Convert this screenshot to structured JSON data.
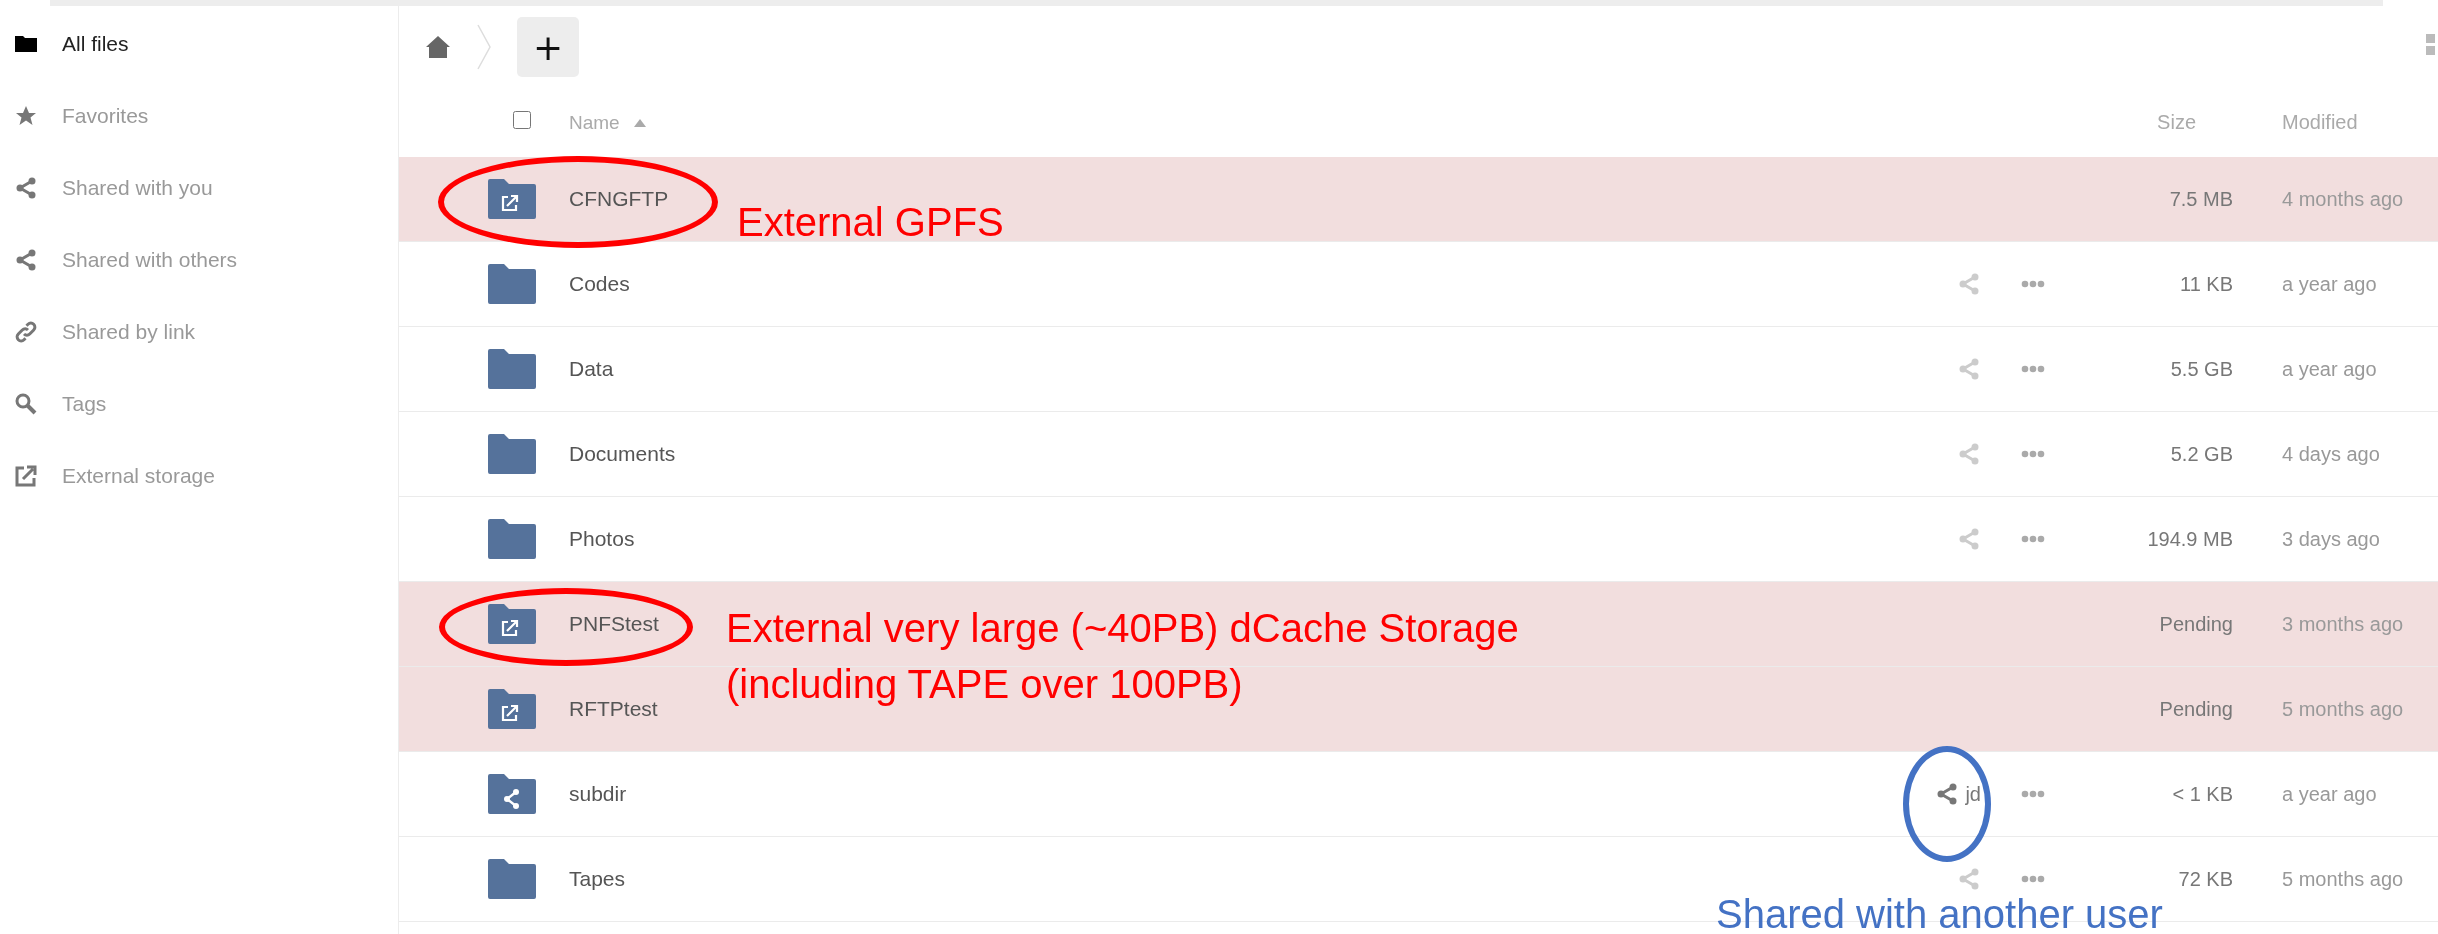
{
  "sidebar": {
    "items": [
      {
        "label": "All files",
        "selected": true
      },
      {
        "label": "Favorites",
        "selected": false
      },
      {
        "label": "Shared with you",
        "selected": false
      },
      {
        "label": "Shared with others",
        "selected": false
      },
      {
        "label": "Shared by link",
        "selected": false
      },
      {
        "label": "Tags",
        "selected": false
      },
      {
        "label": "External storage",
        "selected": false
      }
    ]
  },
  "toolbar": {
    "new_button": "+"
  },
  "table": {
    "select_all_checked": false,
    "columns": {
      "name": "Name",
      "size": "Size",
      "modified": "Modified"
    },
    "sort_ascending": true,
    "rows": [
      {
        "kind": "external",
        "name": "CFNGFTP",
        "highlighted": true,
        "actions": false,
        "size": "7.5 MB",
        "modified": "4 months ago"
      },
      {
        "kind": "folder",
        "name": "Codes",
        "highlighted": false,
        "actions": true,
        "size": "11 KB",
        "modified": "a year ago"
      },
      {
        "kind": "folder",
        "name": "Data",
        "highlighted": false,
        "actions": true,
        "size": "5.5 GB",
        "modified": "a year ago"
      },
      {
        "kind": "folder",
        "name": "Documents",
        "highlighted": false,
        "actions": true,
        "size": "5.2 GB",
        "modified": "4 days ago"
      },
      {
        "kind": "folder",
        "name": "Photos",
        "highlighted": false,
        "actions": true,
        "size": "194.9 MB",
        "modified": "3 days ago"
      },
      {
        "kind": "external",
        "name": "PNFStest",
        "highlighted": true,
        "actions": false,
        "size": "Pending",
        "modified": "3 months ago"
      },
      {
        "kind": "external",
        "name": "RFTPtest",
        "highlighted": true,
        "actions": false,
        "size": "Pending",
        "modified": "5 months ago"
      },
      {
        "kind": "shared",
        "name": "subdir",
        "highlighted": false,
        "actions": true,
        "shared_with": "jd",
        "size": "< 1 KB",
        "modified": "a year ago"
      },
      {
        "kind": "folder",
        "name": "Tapes",
        "highlighted": false,
        "actions": true,
        "size": "72 KB",
        "modified": "5 months ago"
      }
    ]
  },
  "annotations": [
    {
      "kind": "ellipse",
      "color": "#ff0000"
    },
    {
      "kind": "note",
      "color": "#ff0000",
      "lines": [
        "External GPFS"
      ]
    },
    {
      "kind": "ellipse",
      "color": "#ff0000"
    },
    {
      "kind": "note",
      "color": "#ff0000",
      "lines": [
        "External very large (~40PB) dCache Storage",
        "(including TAPE over 100PB)"
      ]
    },
    {
      "kind": "ellipse",
      "color": "#4472c4"
    },
    {
      "kind": "note",
      "color": "#4472c4",
      "lines": [
        "Shared with another user"
      ]
    }
  ]
}
